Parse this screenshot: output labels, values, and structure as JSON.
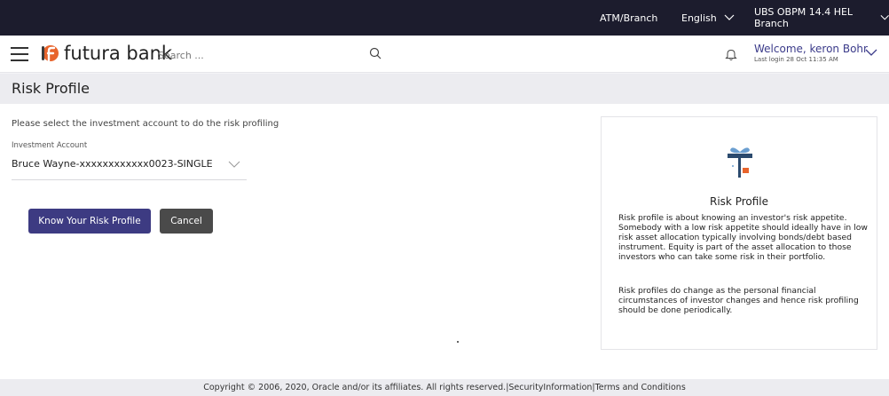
{
  "topbar": {
    "atm_branch": "ATM/Branch",
    "language": "English",
    "branch": "UBS OBPM 14.4 HEL Branch"
  },
  "header": {
    "logo_text": "futura bank",
    "search_placeholder": "Search ...",
    "welcome": "Welcome, keron Bohr",
    "last_login": "Last login 28 Oct 11:35 AM"
  },
  "page": {
    "title": "Risk Profile"
  },
  "form": {
    "instruction": "Please select the investment account to do the risk profiling",
    "account_label": "Investment Account",
    "account_value": "Bruce Wayne-xxxxxxxxxxxx0023-SINGLE",
    "primary_button": "Know Your Risk Profile",
    "cancel_button": "Cancel"
  },
  "info_card": {
    "title": "Risk Profile",
    "para1": "Risk profile is about knowing an investor's risk appetite. Somebody with a low risk appetite should ideally have in low risk asset allocation typically involving bonds/debt based instrument. Equity is part of the asset allocation to those investors who can take some risk in their portfolio.",
    "para2": "Risk profiles do change as the personal financial circumstances of investor changes and hence risk profiling should be done periodically."
  },
  "footer": {
    "copyright": "Copyright © 2006, 2020, Oracle and/or its affiliates. All rights reserved.|SecurityInformation|Terms and Conditions"
  },
  "colors": {
    "topbar_bg": "#1c1c2d",
    "primary": "#3d3b82",
    "cancel": "#4a4a4a",
    "logo_orange": "#e8642c",
    "gift_teal": "#2b4a6e",
    "gift_bow": "#6a9ed0"
  },
  "icons": [
    "hamburger-icon",
    "futura-logo-icon",
    "search-icon",
    "bell-icon",
    "chevron-down-icon",
    "gift-icon"
  ]
}
